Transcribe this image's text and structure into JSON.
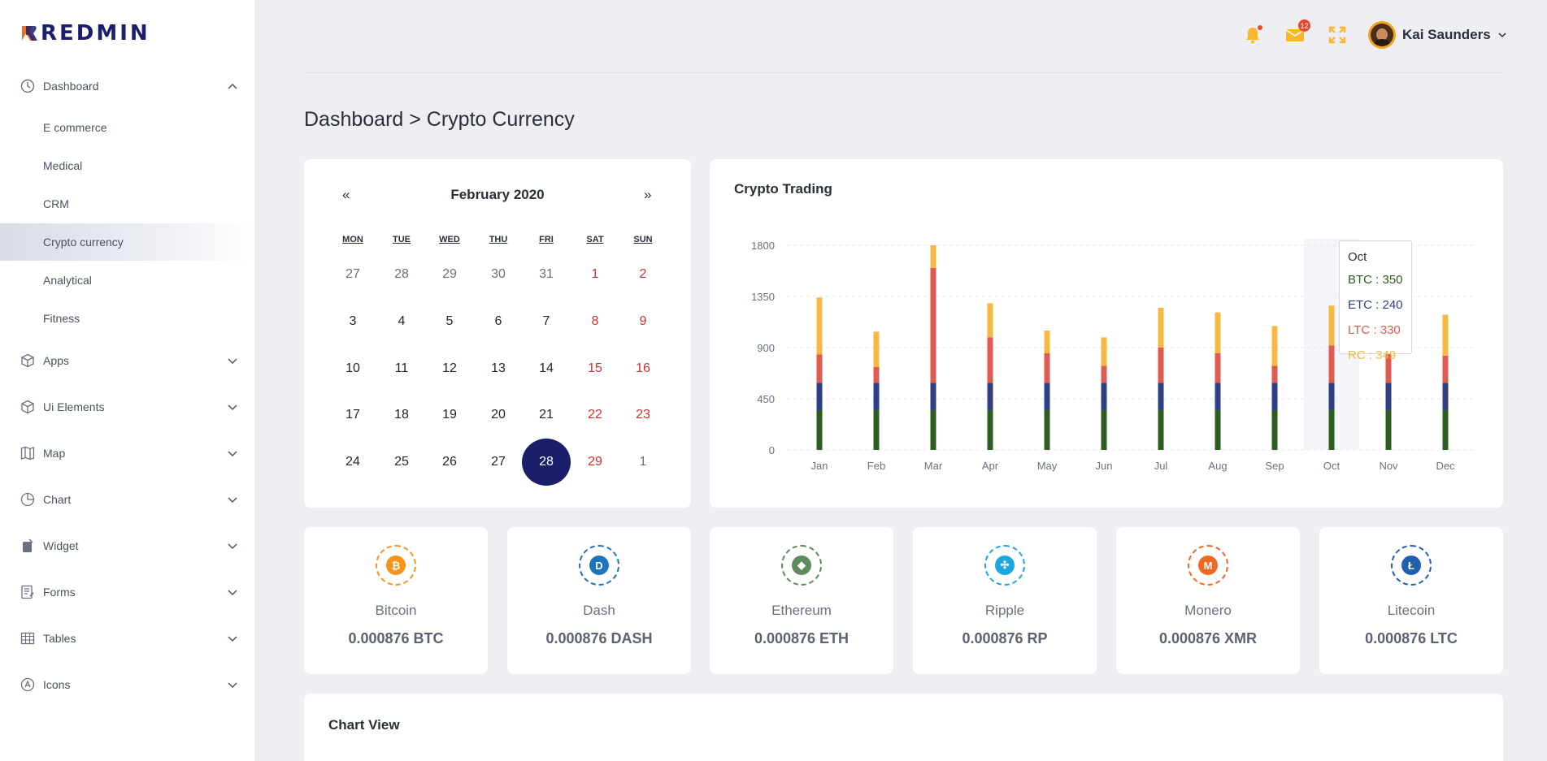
{
  "app": {
    "logo": "REDMIN"
  },
  "sidebar": {
    "dashboard": {
      "label": "Dashboard",
      "subitems": [
        "E commerce",
        "Medical",
        "CRM",
        "Crypto currency",
        "Analytical",
        "Fitness"
      ],
      "active": "Crypto currency"
    },
    "items": [
      {
        "label": "Apps",
        "icon": "box-icon"
      },
      {
        "label": "Ui Elements",
        "icon": "box-icon"
      },
      {
        "label": "Map",
        "icon": "map-icon"
      },
      {
        "label": "Chart",
        "icon": "pie-chart-icon"
      },
      {
        "label": "Widget",
        "icon": "widget-icon"
      },
      {
        "label": "Forms",
        "icon": "form-icon"
      },
      {
        "label": "Tables",
        "icon": "table-icon"
      },
      {
        "label": "Icons",
        "icon": "icons-icon"
      }
    ]
  },
  "header": {
    "mail_badge": "12",
    "user_name": "Kai Saunders"
  },
  "page": {
    "title": "Dashboard > Crypto Currency"
  },
  "calendar": {
    "prev": "«",
    "next": "»",
    "month_label": "February 2020",
    "weekdays": [
      "MON",
      "TUE",
      "WED",
      "THU",
      "FRI",
      "SAT",
      "SUN"
    ],
    "weeks": [
      [
        "27",
        "28",
        "29",
        "30",
        "31",
        "1",
        "2"
      ],
      [
        "3",
        "4",
        "5",
        "6",
        "7",
        "8",
        "9"
      ],
      [
        "10",
        "11",
        "12",
        "13",
        "14",
        "15",
        "16"
      ],
      [
        "17",
        "18",
        "19",
        "20",
        "21",
        "22",
        "23"
      ],
      [
        "24",
        "25",
        "26",
        "27",
        "28",
        "29",
        "1"
      ]
    ],
    "selected": "28"
  },
  "trading": {
    "title": "Crypto Trading",
    "tooltip": {
      "month": "Oct",
      "lines": [
        {
          "text": "BTC : 350",
          "color": "#2e5e1f"
        },
        {
          "text": "ETC : 240",
          "color": "#2f3f83"
        },
        {
          "text": "LTC : 330",
          "color": "#e05a4f"
        },
        {
          "text": "RC : 349",
          "color": "#f7b843"
        }
      ]
    }
  },
  "chart_data": {
    "type": "bar",
    "stacked": true,
    "categories": [
      "Jan",
      "Feb",
      "Mar",
      "Apr",
      "May",
      "Jun",
      "Jul",
      "Aug",
      "Sep",
      "Oct",
      "Nov",
      "Dec"
    ],
    "series": [
      {
        "name": "BTC",
        "color": "#2e5e1f",
        "values": [
          350,
          350,
          350,
          350,
          350,
          350,
          350,
          350,
          350,
          350,
          350,
          350
        ]
      },
      {
        "name": "ETC",
        "color": "#2f3f83",
        "values": [
          240,
          240,
          240,
          240,
          240,
          240,
          240,
          240,
          240,
          240,
          240,
          240
        ]
      },
      {
        "name": "LTC",
        "color": "#e05a4f",
        "values": [
          250,
          140,
          1010,
          400,
          260,
          150,
          310,
          260,
          150,
          330,
          300,
          240
        ]
      },
      {
        "name": "RC",
        "color": "#f7b843",
        "values": [
          500,
          310,
          200,
          300,
          200,
          250,
          350,
          360,
          350,
          349,
          450,
          360
        ]
      }
    ],
    "yticks": [
      0,
      450,
      900,
      1350,
      1800
    ],
    "ylim": [
      0,
      1800
    ],
    "grid": true,
    "highlight": "Oct"
  },
  "coins": [
    {
      "name": "Bitcoin",
      "value": "0.000876 BTC",
      "icon": "bitcoin-icon",
      "color": "#f7931a",
      "glyph": "₿"
    },
    {
      "name": "Dash",
      "value": "0.000876 DASH",
      "icon": "dash-icon",
      "color": "#1c75bc",
      "glyph": "D"
    },
    {
      "name": "Ethereum",
      "value": "0.000876 ETH",
      "icon": "ethereum-icon",
      "color": "#5f8a5c",
      "glyph": "◆"
    },
    {
      "name": "Ripple",
      "value": "0.000876 RP",
      "icon": "ripple-icon",
      "color": "#1aa7e0",
      "glyph": "✣"
    },
    {
      "name": "Monero",
      "value": "0.000876 XMR",
      "icon": "monero-icon",
      "color": "#f26822",
      "glyph": "M"
    },
    {
      "name": "Litecoin",
      "value": "0.000876 LTC",
      "icon": "litecoin-icon",
      "color": "#1f5fae",
      "glyph": "Ł"
    }
  ],
  "chart_view": {
    "title": "Chart View"
  }
}
